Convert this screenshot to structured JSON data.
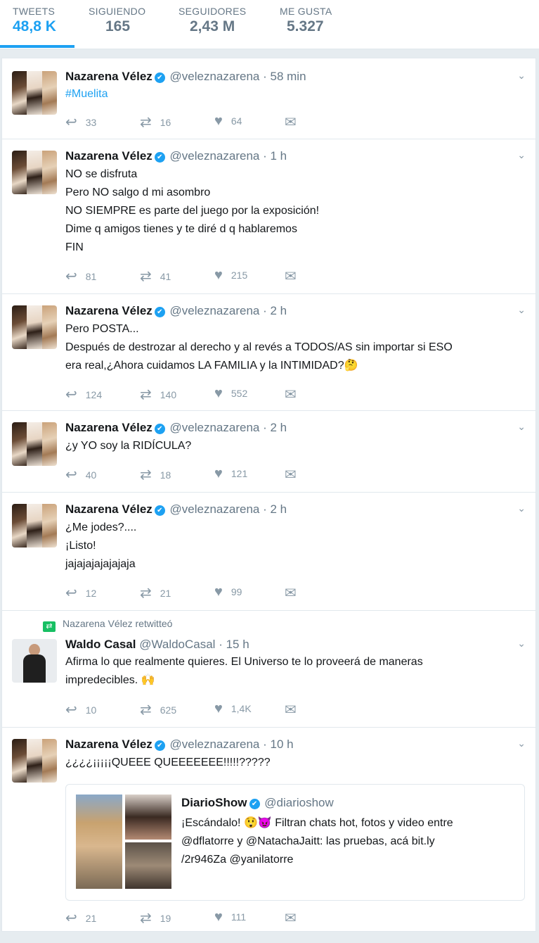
{
  "stats": [
    {
      "label": "TWEETS",
      "value": "48,8 K"
    },
    {
      "label": "SIGUIENDO",
      "value": "165"
    },
    {
      "label": "SEGUIDORES",
      "value": "2,43 M"
    },
    {
      "label": "ME GUSTA",
      "value": "5.327"
    }
  ],
  "tweets": [
    {
      "name": "Nazarena Vélez",
      "handle": "@veleznazarena",
      "time": "· 58 min",
      "hashtag": "#Muelita",
      "reply": "33",
      "retweet": "16",
      "like": "64"
    },
    {
      "name": "Nazarena Vélez",
      "handle": "@veleznazarena",
      "time": "· 1 h",
      "lines": [
        "NO se disfruta",
        "Pero NO salgo d mi asombro",
        "NO SIEMPRE es parte del juego por la exposición!",
        "Dime q amigos tienes y te diré d q hablaremos",
        "FIN"
      ],
      "reply": "81",
      "retweet": "41",
      "like": "215"
    },
    {
      "name": "Nazarena Vélez",
      "handle": "@veleznazarena",
      "time": "· 2 h",
      "lines": [
        "Pero POSTA...",
        "Después de destrozar al derecho y al revés a TODOS/AS sin importar si ESO",
        "era real,¿Ahora cuidamos LA FAMILIA y la INTIMIDAD?🤔"
      ],
      "reply": "124",
      "retweet": "140",
      "like": "552"
    },
    {
      "name": "Nazarena Vélez",
      "handle": "@veleznazarena",
      "time": "· 2 h",
      "lines": [
        "¿y YO soy la RIDÍCULA?"
      ],
      "reply": "40",
      "retweet": "18",
      "like": "121"
    },
    {
      "name": "Nazarena Vélez",
      "handle": "@veleznazarena",
      "time": "· 2 h",
      "lines": [
        "¿Me jodes?....",
        "¡Listo!",
        "jajajajajajajaja"
      ],
      "reply": "12",
      "retweet": "21",
      "like": "99"
    },
    {
      "retweeted_by": "Nazarena Vélez retwitteó",
      "name": "Waldo Casal",
      "handle": "@WaldoCasal",
      "time": "· 15 h",
      "lines": [
        "Afirma lo que realmente quieres. El Universo te lo proveerá de maneras",
        "impredecibles. 🙌"
      ],
      "reply": "10",
      "retweet": "625",
      "like": "1,4K"
    },
    {
      "name": "Nazarena Vélez",
      "handle": "@veleznazarena",
      "time": "· 10 h",
      "lines": [
        "¿¿¿¿¡¡¡¡¡QUEEE QUEEEEEEE!!!!!?????"
      ],
      "quote": {
        "name": "DiarioShow",
        "handle": "@diarioshow",
        "lines": [
          "¡Escándalo! 😲😈 Filtran chats hot, fotos y video entre",
          "@dflatorre y @NatachaJaitt: las pruebas, acá bit.ly",
          "/2r946Za @yanilatorre"
        ]
      },
      "reply": "21",
      "retweet": "19",
      "like": "111"
    }
  ],
  "icons": {
    "reply": "reply-icon",
    "retweet": "retweet-icon",
    "like": "heart-icon",
    "dm": "envelope-icon",
    "verified": "verified-badge-icon",
    "caret": "chevron-down-icon"
  },
  "colors": {
    "accent": "#1da1f2",
    "retweet_badge": "#17bf63",
    "muted": "#657786"
  }
}
